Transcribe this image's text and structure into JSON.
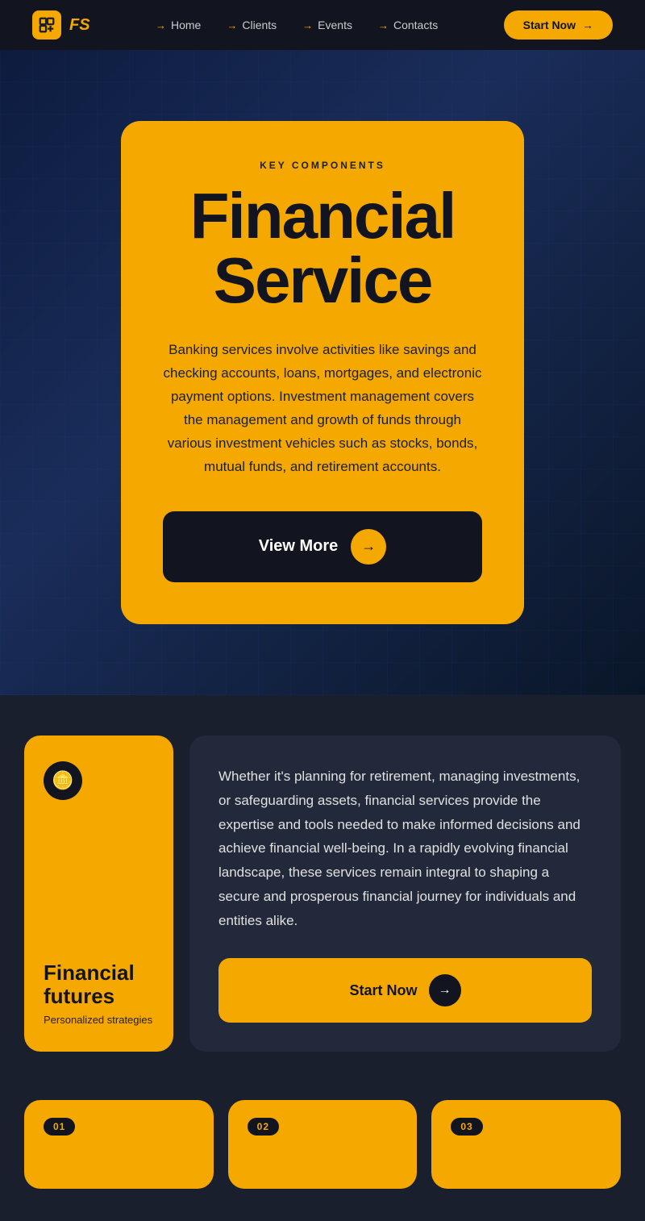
{
  "nav": {
    "logo_text": "FS",
    "links": [
      {
        "label": "Home",
        "id": "home"
      },
      {
        "label": "Clients",
        "id": "clients"
      },
      {
        "label": "Events",
        "id": "events"
      },
      {
        "label": "Contacts",
        "id": "contacts"
      }
    ],
    "cta_label": "Start Now"
  },
  "hero": {
    "eyebrow": "KEY COMPONENTS",
    "title_line1": "Financial",
    "title_line2": "Service",
    "description": "Banking services involve activities like savings and checking accounts, loans, mortgages, and electronic payment options. Investment management covers the management and growth of funds through various investment vehicles such as stocks, bonds, mutual funds, and retirement accounts.",
    "btn_label": "View More"
  },
  "info_card": {
    "icon": "🪙",
    "title": "Financial futures",
    "subtitle": "Personalized strategies",
    "body": "Whether it's planning for retirement, managing investments, or safeguarding assets, financial services provide the expertise and tools needed to make informed decisions and achieve financial well-being. In a rapidly evolving financial landscape, these services remain integral to shaping a secure and prosperous financial journey for individuals and entities alike.",
    "btn_label": "Start Now"
  },
  "bottom_cards": [
    {
      "num": "01"
    },
    {
      "num": "02"
    },
    {
      "num": "03"
    }
  ]
}
